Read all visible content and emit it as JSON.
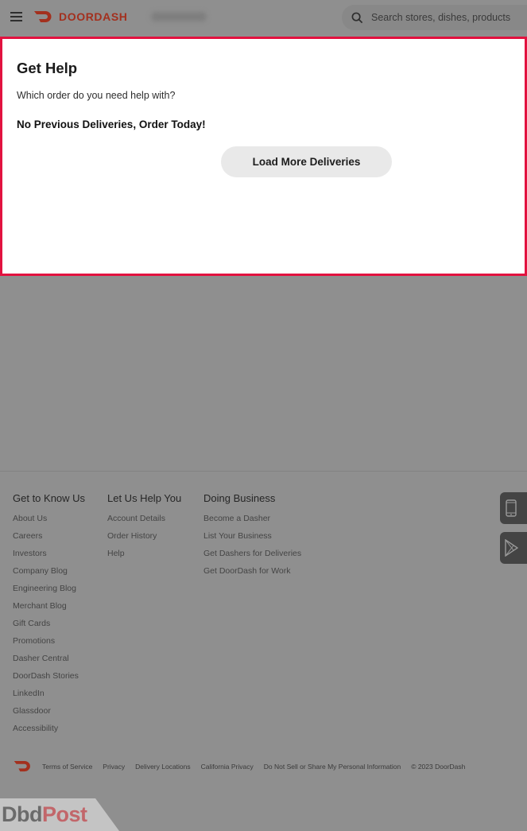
{
  "header": {
    "brand": "DOORDASH",
    "search_placeholder": "Search stores, dishes, products",
    "colors": {
      "brand": "#a3301e"
    }
  },
  "panel": {
    "title": "Get Help",
    "subtitle": "Which order do you need help with?",
    "empty_message": "No Previous Deliveries, Order Today!",
    "load_more_label": "Load More Deliveries",
    "highlight_color": "#e2123f"
  },
  "footer": {
    "columns": [
      {
        "heading": "Get to Know Us",
        "links": [
          "About Us",
          "Careers",
          "Investors",
          "Company Blog",
          "Engineering Blog",
          "Merchant Blog",
          "Gift Cards",
          "Promotions",
          "Dasher Central",
          "DoorDash Stories",
          "LinkedIn",
          "Glassdoor",
          "Accessibility"
        ]
      },
      {
        "heading": "Let Us Help You",
        "links": [
          "Account Details",
          "Order History",
          "Help"
        ]
      },
      {
        "heading": "Doing Business",
        "links": [
          "Become a Dasher",
          "List Your Business",
          "Get Dashers for Deliveries",
          "Get DoorDash for Work"
        ]
      }
    ],
    "app_buttons": [
      {
        "icon": "phone-icon",
        "label": "iOS app"
      },
      {
        "icon": "google-play-icon",
        "label": "Android app"
      }
    ],
    "legal_links": [
      "Terms of Service",
      "Privacy",
      "Delivery Locations",
      "California Privacy",
      "Do Not Sell or Share My Personal Information"
    ],
    "copyright": "© 2023 DoorDash"
  },
  "watermark": {
    "part1": "Dbd",
    "part2": "Post"
  }
}
